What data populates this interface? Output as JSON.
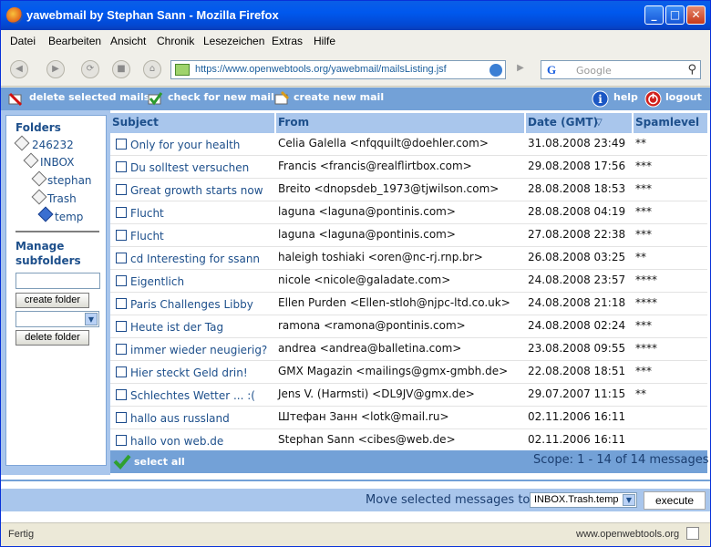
{
  "window": {
    "title": "yawebmail by Stephan Sann - Mozilla Firefox",
    "minimize": "_",
    "maximize": "□",
    "close": "✕"
  },
  "menu": [
    "Datei",
    "Bearbeiten",
    "Ansicht",
    "Chronik",
    "Lesezeichen",
    "Extras",
    "Hilfe"
  ],
  "nav": {
    "back": "◀",
    "forward": "▶",
    "url": "https://www.openwebtools.org/yawebmail/mailsListing.jsf",
    "search_placeholder": "Google",
    "search_engine": "G"
  },
  "toolbar": {
    "delete_label": "delete selected mails",
    "check_label": "check for new mail",
    "create_label": "create new mail",
    "help_label": "help",
    "logout_label": "logout"
  },
  "sidebar": {
    "folders_heading": "Folders",
    "folders": [
      {
        "name": "246232"
      },
      {
        "name": "INBOX"
      },
      {
        "name": "stephan"
      },
      {
        "name": "Trash"
      },
      {
        "name": "temp"
      }
    ],
    "manage_heading_1": "Manage",
    "manage_heading_2": "subfolders",
    "create_button": "create folder",
    "delete_button": "delete folder"
  },
  "table": {
    "headers": {
      "subject": "Subject",
      "from": "From",
      "date": "Date (GMT)",
      "sort_indicator": "▽",
      "spam": "Spamlevel"
    },
    "rows": [
      {
        "subject": "Only for your health",
        "from": "Celia Galella <nfqquilt@doehler.com>",
        "date": "31.08.2008 23:49",
        "spam": "**"
      },
      {
        "subject": "Du solltest versuchen",
        "from": "Francis <francis@realflirtbox.com>",
        "date": "29.08.2008 17:56",
        "spam": "***"
      },
      {
        "subject": "Great growth starts now",
        "from": "Breito <dnopsdeb_1973@tjwilson.com>",
        "date": "28.08.2008 18:53",
        "spam": "***"
      },
      {
        "subject": "Flucht",
        "from": "laguna <laguna@pontinis.com>",
        "date": "28.08.2008 04:19",
        "spam": "***"
      },
      {
        "subject": "Flucht",
        "from": "laguna <laguna@pontinis.com>",
        "date": "27.08.2008 22:38",
        "spam": "***"
      },
      {
        "subject": "cd Interesting for ssann",
        "from": "haleigh toshiaki <oren@nc-rj.rnp.br>",
        "date": "26.08.2008 03:25",
        "spam": "**"
      },
      {
        "subject": "Eigentlich",
        "from": "nicole <nicole@galadate.com>",
        "date": "24.08.2008 23:57",
        "spam": "****"
      },
      {
        "subject": "Paris Challenges Libby",
        "from": "Ellen Purden <Ellen-stloh@njpc-ltd.co.uk>",
        "date": "24.08.2008 21:18",
        "spam": "****"
      },
      {
        "subject": "Heute ist der Tag",
        "from": "ramona <ramona@pontinis.com>",
        "date": "24.08.2008 02:24",
        "spam": "***"
      },
      {
        "subject": "immer wieder neugierig?",
        "from": "andrea <andrea@balletina.com>",
        "date": "23.08.2008 09:55",
        "spam": "****"
      },
      {
        "subject": "Hier steckt Geld drin!",
        "from": "GMX Magazin <mailings@gmx-gmbh.de>",
        "date": "22.08.2008 18:51",
        "spam": "***"
      },
      {
        "subject": "Schlechtes Wetter ... :(",
        "from": "Jens V. (Harmsti) <DL9JV@gmx.de>",
        "date": "29.07.2007 11:15",
        "spam": "**"
      },
      {
        "subject": "hallo aus russland",
        "from": "Штефан Занн <lotk@mail.ru>",
        "date": "02.11.2006 16:11",
        "spam": ""
      },
      {
        "subject": "hallo von web.de",
        "from": "Stephan Sann <cibes@web.de>",
        "date": "02.11.2006 16:11",
        "spam": ""
      }
    ]
  },
  "footer": {
    "select_all": "select all",
    "scope": "Scope: 1 - 14 of 14 messages"
  },
  "move": {
    "label": "Move selected messages to",
    "selected_folder": "INBOX.Trash.temp",
    "execute": "execute"
  },
  "status": {
    "left": "Fertig",
    "right": "www.openwebtools.org"
  },
  "colors": {
    "toolbar_blue": "#73a1d7",
    "header_blue": "#a9c6ec",
    "link_blue": "#1d4f8b",
    "title_blue": "#0058ee"
  }
}
